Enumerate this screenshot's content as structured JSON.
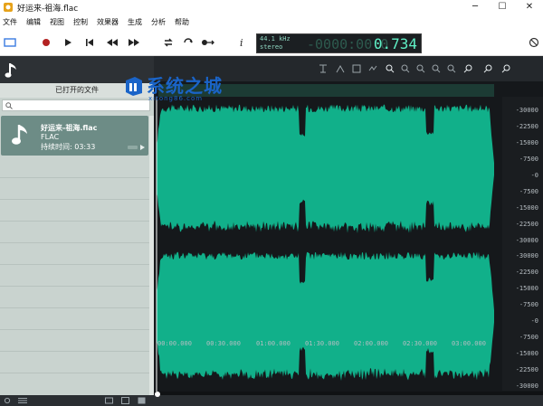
{
  "window": {
    "title": "好运来-祖海.flac",
    "controls": [
      "minimize",
      "maximize",
      "close"
    ]
  },
  "menu": {
    "items": [
      "文件",
      "编辑",
      "视图",
      "控制",
      "效果器",
      "生成",
      "分析",
      "帮助"
    ]
  },
  "toolbar": {
    "display": {
      "sample_rate": "44.1 kHz",
      "channels": "stereo",
      "ghost": "-0000:00:0",
      "time": "0.734"
    },
    "volume_level": 0.88
  },
  "left_panel": {
    "header_icon": "music-note-icon",
    "title": "已打开的文件",
    "search": {
      "placeholder": "",
      "value": ""
    },
    "files": [
      {
        "title": "好运来-祖海.flac",
        "format": "FLAC",
        "duration": "持续时间: 03:33"
      }
    ]
  },
  "editor": {
    "amplitude_labels": [
      "-30000",
      "-22500",
      "-15000",
      "-7500",
      "-0",
      "-7500",
      "-15000",
      "-22500",
      "-30000"
    ],
    "time_labels": [
      "00:00.000",
      "00:30.000",
      "01:00.000",
      "01:30.000",
      "02:00.000",
      "02:30.000",
      "03:00.000"
    ],
    "waveform_color": "#11b08a",
    "background_color": "#15181b"
  },
  "watermark": {
    "text": "系统之城",
    "sub": "xitong86.com"
  }
}
